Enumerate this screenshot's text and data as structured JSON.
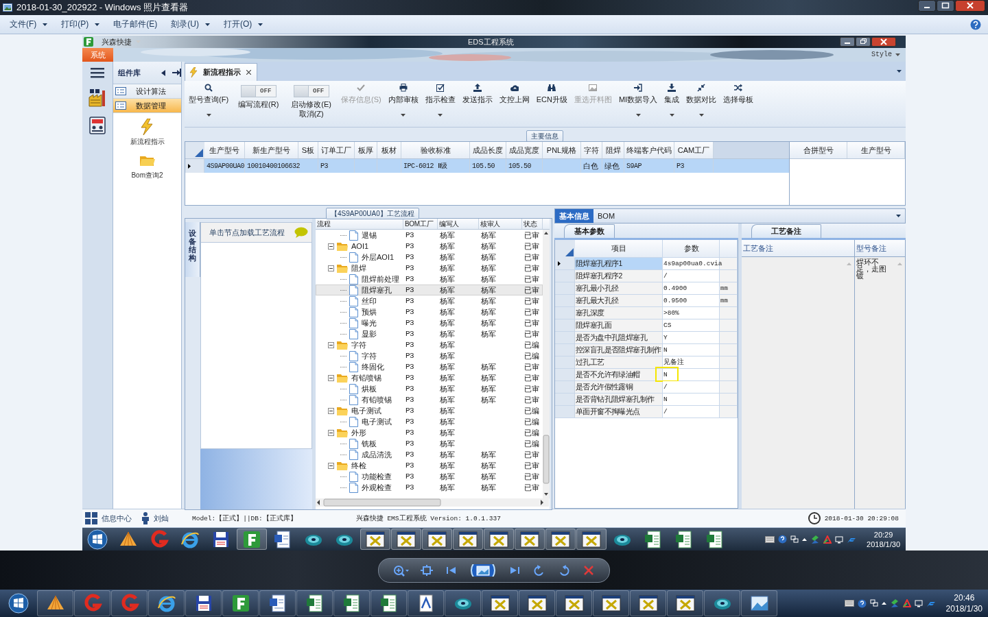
{
  "viewer": {
    "title": "2018-01-30_202922 - Windows 照片查看器",
    "menu": [
      {
        "label": "文件(F)",
        "dropdown": true
      },
      {
        "label": "打印(P)",
        "dropdown": true
      },
      {
        "label": "电子邮件(E)",
        "dropdown": false
      },
      {
        "label": "刻录(U)",
        "dropdown": true
      },
      {
        "label": "打开(O)",
        "dropdown": true
      }
    ]
  },
  "app": {
    "quick_access": "兴森快捷",
    "title": "EDS工程系统",
    "system_tab": "系统",
    "style_menu": "Style",
    "component_library": {
      "title": "组件库",
      "groups": [
        {
          "label": "设计算法",
          "selected": false
        },
        {
          "label": "数据管理",
          "selected": true
        }
      ],
      "tools": [
        "新流程指示",
        "Bom查询2"
      ]
    },
    "document_tab": "新流程指示",
    "ribbon": [
      {
        "kind": "button",
        "label": "型号查询(F)",
        "disabled": false,
        "dropdown": true
      },
      {
        "kind": "toggle",
        "label": "编写流程(R)",
        "state_text": "OFF",
        "on": false
      },
      {
        "kind": "toggle",
        "label": "启动修改(E)\n取消(Z)",
        "state_text": "OFF",
        "on": false
      },
      {
        "kind": "button",
        "label": "保存信息(S)",
        "disabled": true,
        "dropdown": false
      },
      {
        "kind": "button",
        "label": "内部审核",
        "disabled": false,
        "dropdown": true
      },
      {
        "kind": "button",
        "label": "指示检查",
        "disabled": false,
        "dropdown": true
      },
      {
        "kind": "button",
        "label": "发送指示",
        "disabled": false,
        "dropdown": false
      },
      {
        "kind": "button",
        "label": "文控上网",
        "disabled": false,
        "dropdown": false
      },
      {
        "kind": "button",
        "label": "ECN升级",
        "disabled": false,
        "dropdown": false
      },
      {
        "kind": "button",
        "label": "重选开料图",
        "disabled": true,
        "dropdown": false
      },
      {
        "kind": "button",
        "label": "MI数据导入",
        "disabled": false,
        "dropdown": true
      },
      {
        "kind": "button",
        "label": "集成",
        "disabled": false,
        "dropdown": true
      },
      {
        "kind": "button",
        "label": "数据对比",
        "disabled": false,
        "dropdown": true
      },
      {
        "kind": "button",
        "label": "选择母板",
        "disabled": false,
        "dropdown": false
      }
    ],
    "main_info": {
      "title": "主要信息",
      "columns": [
        "生产型号",
        "新生产型号",
        "S板",
        "订单工厂",
        "板厚",
        "板材",
        "验收标准",
        "成品长度",
        "成品宽度",
        "PNL规格",
        "字符",
        "阻焊",
        "终端客户代码",
        "CAM工厂"
      ],
      "rows": [
        {
          "selected": true,
          "cells": [
            "4S9AP00UA0",
            "10010400106632",
            null,
            "P3",
            null,
            null,
            "IPC-6012 Ⅱ级",
            "105.50",
            "105.50",
            null,
            "白色",
            "绿色",
            "S9AP",
            "P3"
          ]
        }
      ],
      "merge_columns": [
        "合拼型号",
        "生产型号"
      ]
    },
    "process": {
      "title": "【4S9AP00UA0】工艺流程",
      "side_tab": "设备结构",
      "hint": "单击节点加载工艺流程",
      "columns": [
        "流程",
        "BOM工厂",
        "编写人",
        "核审人",
        "状态"
      ],
      "nodes": [
        {
          "kind": "file",
          "label": "退锡",
          "bom": "P3",
          "author": "杨军",
          "reviewer": "杨军",
          "status": "已审",
          "selected": false
        },
        {
          "kind": "folder",
          "label": "AOI1",
          "bom": "P3",
          "author": "杨军",
          "reviewer": "杨军",
          "status": "已审",
          "selected": false,
          "expanded": true,
          "children": [
            {
              "kind": "file",
              "label": "外层AOI1",
              "bom": "P3",
              "author": "杨军",
              "reviewer": "杨军",
              "status": "已审",
              "selected": false
            }
          ]
        },
        {
          "kind": "folder",
          "label": "阻焊",
          "bom": "P3",
          "author": "杨军",
          "reviewer": "杨军",
          "status": "已审",
          "selected": false,
          "expanded": true,
          "children": [
            {
              "kind": "file",
              "label": "阻焊前处理",
              "bom": "P3",
              "author": "杨军",
              "reviewer": "杨军",
              "status": "已审",
              "selected": false
            },
            {
              "kind": "file",
              "label": "阻焊塞孔",
              "bom": "P3",
              "author": "杨军",
              "reviewer": "杨军",
              "status": "已审",
              "selected": true
            },
            {
              "kind": "file",
              "label": "丝印",
              "bom": "P3",
              "author": "杨军",
              "reviewer": "杨军",
              "status": "已审",
              "selected": false
            },
            {
              "kind": "file",
              "label": "预烘",
              "bom": "P3",
              "author": "杨军",
              "reviewer": "杨军",
              "status": "已审",
              "selected": false
            },
            {
              "kind": "file",
              "label": "曝光",
              "bom": "P3",
              "author": "杨军",
              "reviewer": "杨军",
              "status": "已审",
              "selected": false
            },
            {
              "kind": "file",
              "label": "显影",
              "bom": "P3",
              "author": "杨军",
              "reviewer": "杨军",
              "status": "已审",
              "selected": false
            }
          ]
        },
        {
          "kind": "folder",
          "label": "字符",
          "bom": "P3",
          "author": "杨军",
          "status": "已编",
          "selected": false,
          "expanded": true,
          "children": [
            {
              "kind": "file",
              "label": "字符",
              "bom": "P3",
              "author": "杨军",
              "status": "已编",
              "selected": false
            },
            {
              "kind": "file",
              "label": "终固化",
              "bom": "P3",
              "author": "杨军",
              "reviewer": "杨军",
              "status": "已审",
              "selected": false
            }
          ]
        },
        {
          "kind": "folder",
          "label": "有铅喷锡",
          "bom": "P3",
          "author": "杨军",
          "reviewer": "杨军",
          "status": "已审",
          "selected": false,
          "expanded": true,
          "children": [
            {
              "kind": "file",
              "label": "烘板",
              "bom": "P3",
              "author": "杨军",
              "reviewer": "杨军",
              "status": "已审",
              "selected": false
            },
            {
              "kind": "file",
              "label": "有铅喷锡",
              "bom": "P3",
              "author": "杨军",
              "reviewer": "杨军",
              "status": "已审",
              "selected": false
            }
          ]
        },
        {
          "kind": "folder",
          "label": "电子测试",
          "bom": "P3",
          "author": "杨军",
          "status": "已编",
          "selected": false,
          "expanded": true,
          "children": [
            {
              "kind": "file",
              "label": "电子测试",
              "bom": "P3",
              "author": "杨军",
              "status": "已编",
              "selected": false
            }
          ]
        },
        {
          "kind": "folder",
          "label": "外形",
          "bom": "P3",
          "author": "杨军",
          "status": "已编",
          "selected": false,
          "expanded": true,
          "children": [
            {
              "kind": "file",
              "label": "铣板",
              "bom": "P3",
              "author": "杨军",
              "status": "已编",
              "selected": false
            },
            {
              "kind": "file",
              "label": "成品清洗",
              "bom": "P3",
              "author": "杨军",
              "reviewer": "杨军",
              "status": "已审",
              "selected": false
            }
          ]
        },
        {
          "kind": "folder",
          "label": "终检",
          "bom": "P3",
          "author": "杨军",
          "reviewer": "杨军",
          "status": "已审",
          "selected": false,
          "expanded": true,
          "children": [
            {
              "kind": "file",
              "label": "功能检查",
              "bom": "P3",
              "author": "杨军",
              "reviewer": "杨军",
              "status": "已审",
              "selected": false
            },
            {
              "kind": "file",
              "label": "外观检查",
              "bom": "P3",
              "author": "杨军",
              "reviewer": "杨军",
              "status": "已审",
              "selected": false
            }
          ]
        }
      ]
    },
    "details": {
      "tabs": [
        {
          "label": "基本信息",
          "selected": true
        },
        {
          "label": "BOM",
          "selected": false
        }
      ],
      "params_tab": "基本参数",
      "columns": [
        "项目",
        "参数"
      ],
      "rows": [
        {
          "item": "阻焊塞孔程序1",
          "value": "4s9ap00ua0.cvia",
          "selected": true,
          "highlighted": false
        },
        {
          "item": "阻焊塞孔程序2",
          "value": "/",
          "selected": false,
          "highlighted": false
        },
        {
          "item": "塞孔最小孔径",
          "value": "0.4900",
          "unit": "mm",
          "selected": false,
          "highlighted": false
        },
        {
          "item": "塞孔最大孔径",
          "value": "0.9500",
          "unit": "mm",
          "selected": false,
          "highlighted": false
        },
        {
          "item": "塞孔深度",
          "value": ">80%",
          "selected": false,
          "highlighted": false
        },
        {
          "item": "阻焊塞孔面",
          "value": "CS",
          "selected": false,
          "highlighted": false
        },
        {
          "item": "是否为盘中孔阻焊塞孔",
          "value": "Y",
          "selected": false,
          "highlighted": false
        },
        {
          "item": "控深盲孔是否阻焊塞孔制作",
          "value": "N",
          "selected": false,
          "highlighted": false
        },
        {
          "item": "过孔工艺",
          "value": "见备注",
          "selected": false,
          "highlighted": false
        },
        {
          "item": "是否不允许有绿油帽",
          "value": "N",
          "selected": false,
          "highlighted": true
        },
        {
          "item": "是否允许假性露铜",
          "value": "/",
          "selected": false,
          "highlighted": false
        },
        {
          "item": "是否背钻孔阻焊塞孔制作",
          "value": "N",
          "selected": false,
          "highlighted": false
        },
        {
          "item": "单面开窗不掏曝光点",
          "value": "/",
          "selected": false,
          "highlighted": false
        }
      ],
      "notes_tab": "工艺备注",
      "notes_columns": [
        "工艺备注",
        "型号备注"
      ],
      "model_note": "焊环不足，走图镀"
    },
    "status_bar": {
      "info_center": "信息中心",
      "user": "刘灿",
      "database": "Model:【正式】||DB:【正式库】",
      "version": "兴森快捷 EMS工程系统 Version: 1.0.1.337",
      "clock": "2018-01-30 20:29:08"
    },
    "taskbar": {
      "time": "20:29",
      "date": "2018/1/30"
    }
  },
  "taskbar": {
    "time": "20:46",
    "date": "2018/1/30"
  }
}
